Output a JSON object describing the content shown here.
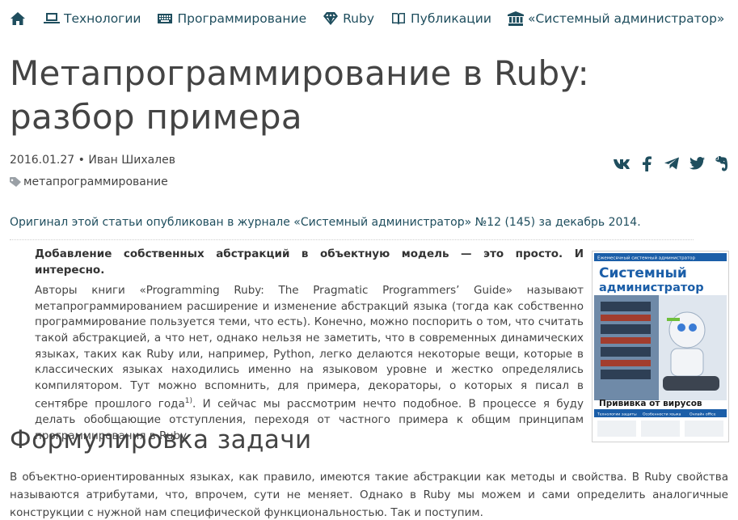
{
  "nav": {
    "items": [
      {
        "label": "Технологии"
      },
      {
        "label": "Программирование"
      },
      {
        "label": "Ruby"
      },
      {
        "label": "Публикации"
      },
      {
        "label": "«Системный администратор»"
      }
    ]
  },
  "article": {
    "title": "Метапрограммирование в Ruby: разбор примера",
    "date": "2016.01.27",
    "separator": "•",
    "author": "Иван Шихалев",
    "tag": "метапрограммирование",
    "intro": "Оригинал этой статьи опубликован в журнале «Системный администратор» №12 (145) за декабрь 2014.",
    "abstract_lead": "Добавление собственных абстракций в объектную модель — это просто. И интересно.",
    "abstract_text_1": "Авторы книги «Programming Ruby: The Pragmatic Programmers’ Guide» называют метапрограммированием расширение и изменение абстракций языка (тогда как собственно программирование пользуется теми, что есть). Конечно, можно поспорить о том, что считать такой абстракцией, а что нет, однако нельзя не заметить, что в современных динамических языках, таких как Ruby или, например, Python, легко делаются некоторые вещи, которые в классических языках находились именно на языковом уровне и жестко определялись компилятором. Тут можно вспомнить, для примера, декораторы, о которых я писал в сентябре прошлого года",
    "footnote_ref": "1)",
    "abstract_text_2": ". И сейчас мы рассмотрим нечто подобное. В процессе я буду делать обобщающие отступления, переходя от частного примера к общим принципам программирования в Ruby.",
    "section_heading": "Формулировка задачи",
    "section_text": "В объектно-ориентированных языках, как правило, имеются такие абстракции как методы и свойства. В Ruby свойства называются атрибутами, что, впрочем, сути не меняет. Однако в Ruby мы можем и сами определить аналогичные конструкции с нужной нам специфической функциональностью. Так и поступим."
  },
  "magazine_cover": {
    "top_line": "Ежемесячный системный администратор",
    "title_line_1": "Системный",
    "title_line_2": "администратор",
    "headline": "Прививка от вирусов",
    "columns": [
      "Технологии защиты",
      "Особенности языка",
      "Онлайн office"
    ]
  },
  "colors": {
    "link": "#1f4e5e",
    "text": "#444444",
    "cover_blue": "#1b5ea8"
  },
  "share_icons": [
    "vk-icon",
    "facebook-icon",
    "telegram-icon",
    "twitter-icon",
    "evernote-icon"
  ]
}
